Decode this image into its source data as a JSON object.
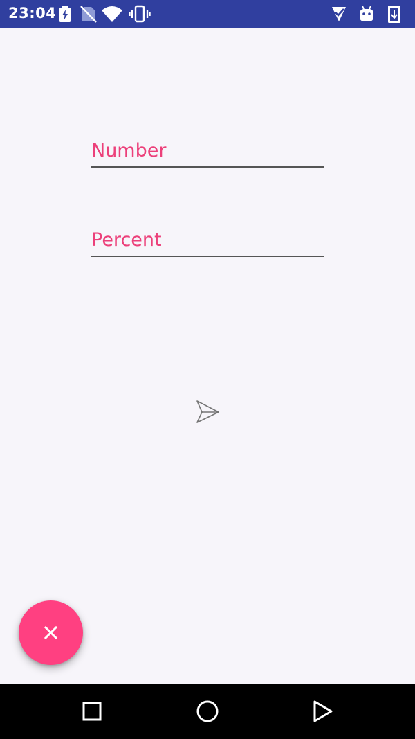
{
  "status_bar": {
    "time": "23:04",
    "icons": [
      "battery-charging-icon",
      "no-sim-icon",
      "wifi-icon",
      "vibrate-icon",
      "check-app-icon",
      "android-debug-icon",
      "download-icon"
    ]
  },
  "form": {
    "number_field": {
      "hint": "Number",
      "value": ""
    },
    "percent_field": {
      "hint": "Percent",
      "value": ""
    }
  },
  "buttons": {
    "send_icon": "send-icon",
    "fab_icon": "close-icon"
  },
  "nav_bar": {
    "icons": [
      "recents-square-icon",
      "home-circle-icon",
      "back-triangle-icon"
    ]
  },
  "colors": {
    "status_bar": "#303f9f",
    "accent": "#ec407a",
    "fab": "#ff4081",
    "background": "#f7f5fa",
    "nav_bar": "#000000"
  }
}
